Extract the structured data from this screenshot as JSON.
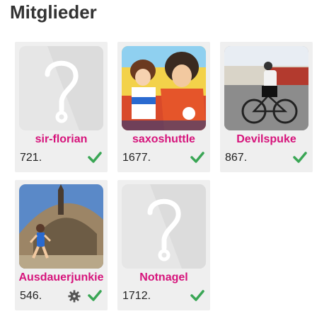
{
  "page": {
    "title": "Mitglieder"
  },
  "colors": {
    "name": "#d6137b",
    "check": "#3aa655",
    "gear": "#555555"
  },
  "members": [
    {
      "name": "sir-florian",
      "rank": "721.",
      "avatar": "placeholder-question-icon",
      "status": "check-icon"
    },
    {
      "name": "saxoshuttle",
      "rank": "1677.",
      "avatar": "photo",
      "status": "check-icon"
    },
    {
      "name": "Devilspuke",
      "rank": "867.",
      "avatar": "photo",
      "status": "check-icon"
    },
    {
      "name": "Ausdauerjunkie",
      "rank": "546.",
      "avatar": "photo",
      "status": "check-icon",
      "extra_icon": "gear-icon"
    },
    {
      "name": "Notnagel",
      "rank": "1712.",
      "avatar": "placeholder-question-icon",
      "status": "check-icon"
    }
  ]
}
